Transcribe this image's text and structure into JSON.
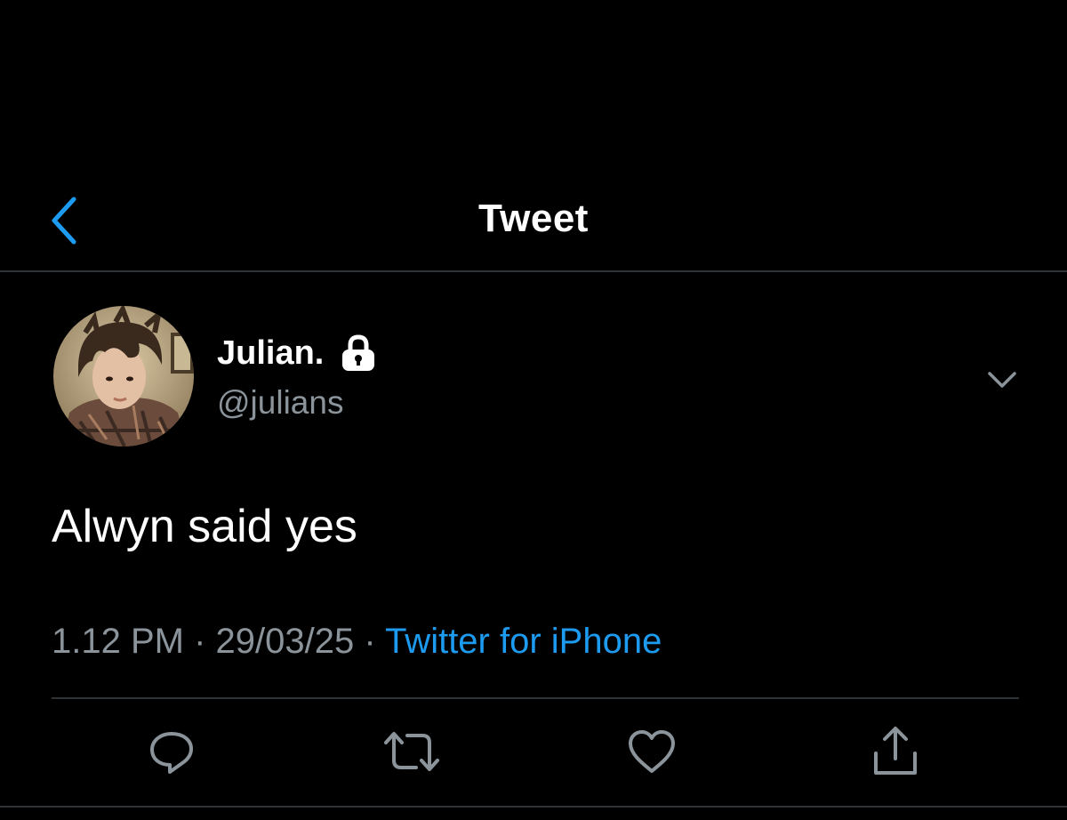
{
  "header": {
    "title": "Tweet",
    "back_icon": "chevron-left-icon"
  },
  "tweet": {
    "author": {
      "display_name": "Julian.",
      "handle": "@julians",
      "protected_icon": "lock-icon"
    },
    "text": "Alwyn said yes",
    "time": "1.12 PM",
    "separator": "·",
    "date": "29/03/25",
    "source": "Twitter for iPhone",
    "more_icon": "chevron-down-icon"
  },
  "actions": [
    {
      "name": "reply",
      "icon": "reply-icon"
    },
    {
      "name": "retweet",
      "icon": "retweet-icon"
    },
    {
      "name": "like",
      "icon": "heart-icon"
    },
    {
      "name": "share",
      "icon": "share-icon"
    }
  ],
  "colors": {
    "background": "#000000",
    "accent": "#1d9bf0",
    "secondary_text": "#8b949b",
    "divider": "#2f3336"
  }
}
